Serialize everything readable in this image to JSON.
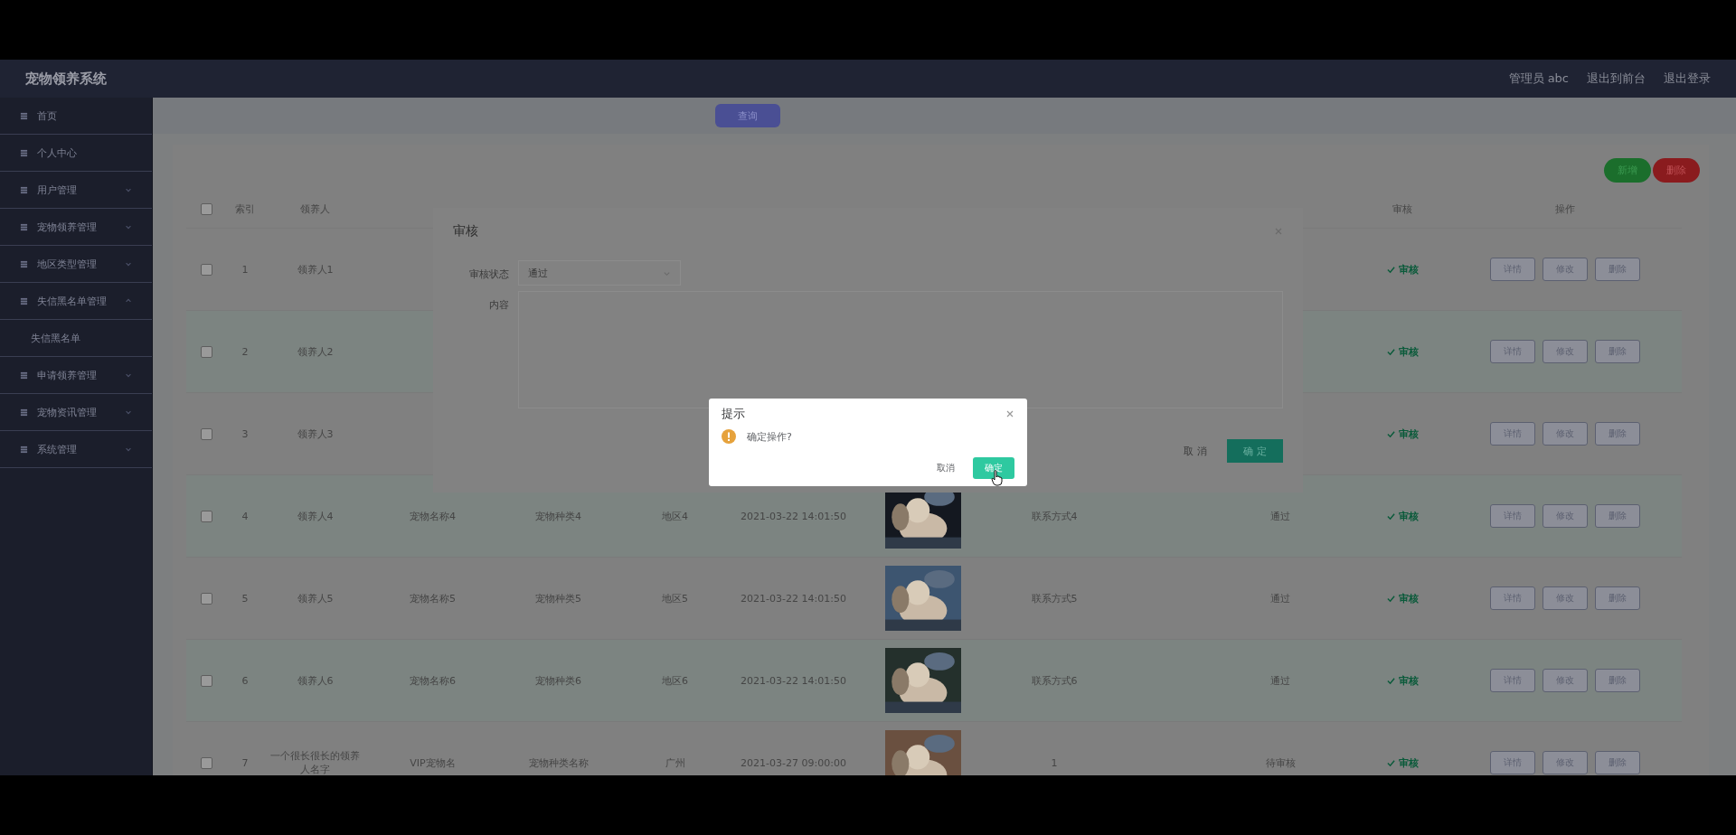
{
  "header": {
    "title": "宠物领养系统",
    "user": "管理员 abc",
    "links": [
      "退出到前台",
      "退出登录"
    ]
  },
  "sidebar": {
    "items": [
      {
        "label": "首页",
        "kind": "link"
      },
      {
        "label": "个人中心",
        "kind": "link"
      },
      {
        "label": "用户管理",
        "kind": "menu",
        "expanded": false
      },
      {
        "label": "宠物领养管理",
        "kind": "menu",
        "expanded": false
      },
      {
        "label": "地区类型管理",
        "kind": "menu",
        "expanded": false
      },
      {
        "label": "失信黑名单管理",
        "kind": "menu",
        "expanded": true,
        "children": [
          {
            "label": "失信黑名单"
          }
        ]
      },
      {
        "label": "申请领养管理",
        "kind": "menu",
        "expanded": false
      },
      {
        "label": "宠物资讯管理",
        "kind": "menu",
        "expanded": false
      },
      {
        "label": "系统管理",
        "kind": "menu",
        "expanded": false
      }
    ]
  },
  "toolbar": {
    "search_button": "查询",
    "add_button": "新增",
    "delete_button": "删除"
  },
  "table": {
    "all_checked": false,
    "header_left": [
      "索引",
      "领养人"
    ],
    "header_right": [
      "审核",
      "操作"
    ],
    "rows": [
      {
        "checked": false,
        "index": "1",
        "name": "领养人1",
        "review": "审核",
        "actions": [
          "详情",
          "修改",
          "删除"
        ]
      },
      {
        "checked": false,
        "index": "2",
        "name": "领养人2",
        "review": "审核",
        "actions": [
          "详情",
          "修改",
          "删除"
        ]
      },
      {
        "checked": false,
        "index": "3",
        "name": "领养人3",
        "review": "审核",
        "actions": [
          "详情",
          "修改",
          "删除"
        ]
      },
      {
        "checked": false,
        "index": "4",
        "name": "领养人4",
        "pet": "宠物名称4",
        "breed": "宠物种类4",
        "region": "地区4",
        "time": "2021-03-22 14:01:50",
        "contact": "联系方式4",
        "status": "通过",
        "review": "审核",
        "actions": [
          "详情",
          "修改",
          "删除"
        ]
      },
      {
        "checked": false,
        "index": "5",
        "name": "领养人5",
        "pet": "宠物名称5",
        "breed": "宠物种类5",
        "region": "地区5",
        "time": "2021-03-22 14:01:50",
        "contact": "联系方式5",
        "status": "通过",
        "review": "审核",
        "actions": [
          "详情",
          "修改",
          "删除"
        ]
      },
      {
        "checked": false,
        "index": "6",
        "name": "领养人6",
        "pet": "宠物名称6",
        "breed": "宠物种类6",
        "region": "地区6",
        "time": "2021-03-22 14:01:50",
        "contact": "联系方式6",
        "status": "通过",
        "review": "审核",
        "actions": [
          "详情",
          "修改",
          "删除"
        ]
      },
      {
        "checked": false,
        "index": "7",
        "name": "一个很长很长的领养人名字",
        "pet": "VIP宠物名",
        "breed": "宠物种类名称",
        "region": "广州",
        "time": "2021-03-27 09:00:00",
        "contact": "1",
        "status": "待审核",
        "review": "审核",
        "actions": [
          "详情",
          "修改",
          "删除"
        ]
      }
    ]
  },
  "audit_dialog": {
    "title": "审核",
    "status_label": "审核状态",
    "status_value": "通过",
    "content_label": "内容",
    "buttons": [
      "取 消",
      "确 定"
    ]
  },
  "confirm_dialog": {
    "title": "提示",
    "message": "确定操作?",
    "buttons": [
      "取消",
      "确定"
    ]
  }
}
